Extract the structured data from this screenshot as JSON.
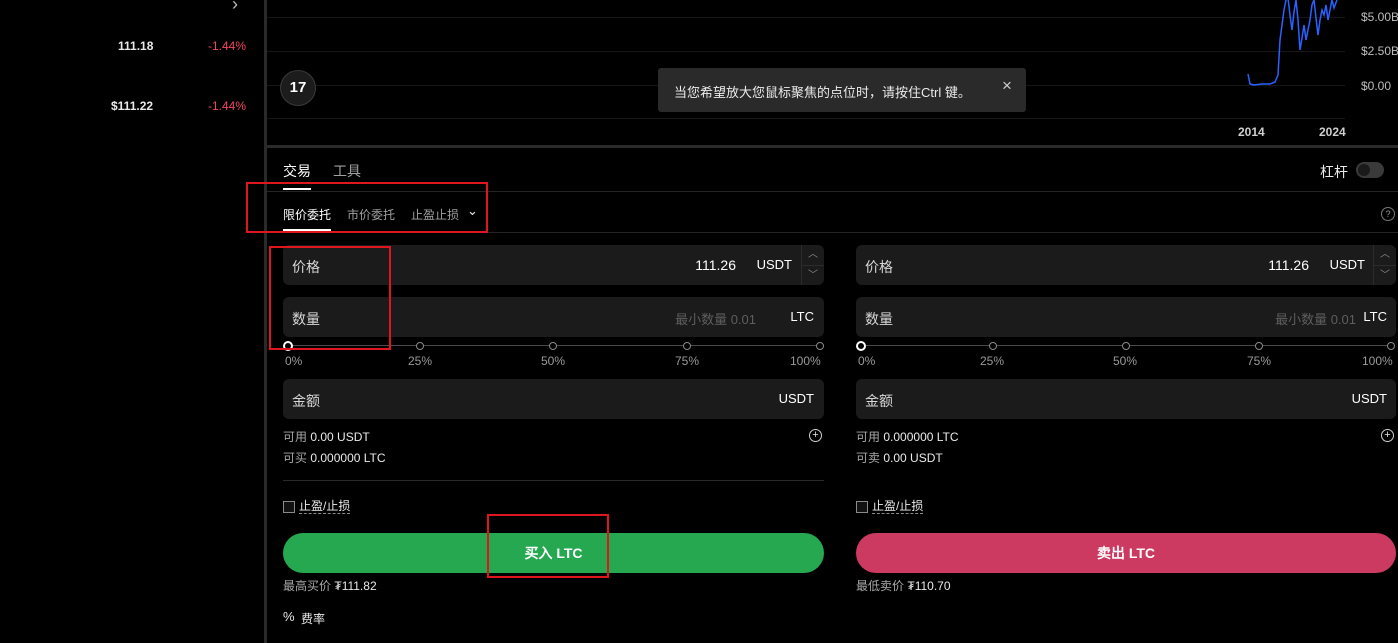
{
  "left_panel": {
    "rows": [
      {
        "price": "111.18",
        "change": "-1.44%"
      },
      {
        "price": "$111.22",
        "change": "-1.44%"
      }
    ]
  },
  "chart": {
    "y_labels": [
      "$5.00B",
      "$2.50B",
      "$0.00"
    ],
    "x_labels": [
      "2014",
      "2024"
    ],
    "logo_text": "17",
    "line_color": "#2962ff"
  },
  "tooltip": {
    "text": "当您希望放大您鼠标聚焦的点位时，请按住Ctrl 键。",
    "close": "×"
  },
  "tabs": {
    "trade": "交易",
    "tools": "工具"
  },
  "leverage": {
    "label": "杠杆",
    "enabled": false
  },
  "order_tabs": {
    "limit": "限价委托",
    "market": "市价委托",
    "stop": "止盈止损",
    "chevron": "⌄"
  },
  "help_icon": "?",
  "buy": {
    "price_label": "价格",
    "price_value": "111.26",
    "price_unit": "USDT",
    "qty_label": "数量",
    "qty_placeholder": "最小数量 0.01",
    "qty_unit": "LTC",
    "slider_labels": [
      "0%",
      "25%",
      "50%",
      "75%",
      "100%"
    ],
    "slider_value": 0,
    "amount_label": "金额",
    "amount_unit": "USDT",
    "avail_label": "可用",
    "avail_value": "0.00 USDT",
    "can_label": "可买",
    "can_value": "0.000000 LTC",
    "tpsl_label": "止盈/止损",
    "button": "买入 LTC",
    "best_label": "最高买价",
    "best_value": "₮111.82"
  },
  "sell": {
    "price_label": "价格",
    "price_value": "111.26",
    "price_unit": "USDT",
    "qty_label": "数量",
    "qty_placeholder": "最小数量 0.01",
    "qty_unit": "LTC",
    "slider_labels": [
      "0%",
      "25%",
      "50%",
      "75%",
      "100%"
    ],
    "slider_value": 0,
    "amount_label": "金额",
    "amount_unit": "USDT",
    "avail_label": "可用",
    "avail_value": "0.000000 LTC",
    "can_label": "可卖",
    "can_value": "0.00 USDT",
    "tpsl_label": "止盈/止损",
    "button": "卖出 LTC",
    "best_label": "最低卖价",
    "best_value": "₮110.70"
  },
  "fee": {
    "icon": "%",
    "label": "费率"
  },
  "colors": {
    "buy": "#25a850",
    "sell": "#cc3a62",
    "negative": "#f0485c",
    "highlight": "#e0161f"
  }
}
